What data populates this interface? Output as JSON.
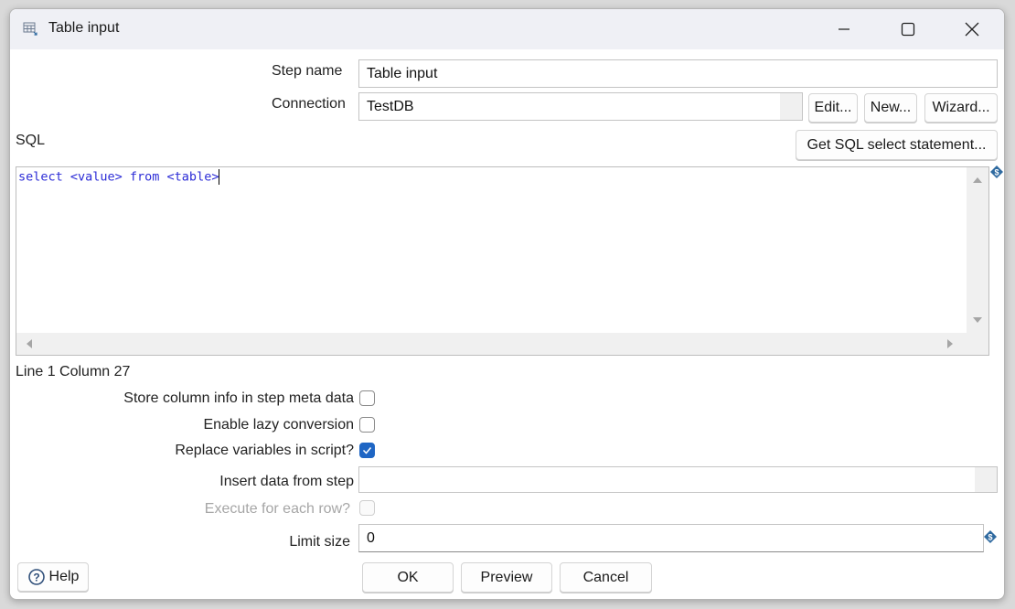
{
  "window": {
    "title": "Table input",
    "controls": [
      "minimize",
      "maximize",
      "close"
    ]
  },
  "form": {
    "step_name_label": "Step name",
    "step_name_value": "Table input",
    "connection_label": "Connection",
    "connection_value": "TestDB",
    "edit_button": "Edit...",
    "new_button": "New...",
    "wizard_button": "Wizard...",
    "sql_label": "SQL",
    "get_sql_button": "Get SQL select statement...",
    "sql_text": "select <value> from <table>",
    "cursor_position": "Line 1 Column 27",
    "store_column_info_label": "Store column info in step meta data",
    "store_column_info_checked": false,
    "lazy_conversion_label": "Enable lazy conversion",
    "lazy_conversion_checked": false,
    "replace_variables_label": "Replace variables in script?",
    "replace_variables_checked": true,
    "insert_data_label": "Insert data from step",
    "insert_data_value": "",
    "execute_each_row_label": "Execute for each row?",
    "execute_each_row_checked": false,
    "execute_each_row_enabled": false,
    "limit_size_label": "Limit size",
    "limit_size_value": "0"
  },
  "footer": {
    "help_button": "Help",
    "ok_button": "OK",
    "preview_button": "Preview",
    "cancel_button": "Cancel"
  },
  "colors": {
    "sql_text": "#2b2bd6",
    "checkbox_checked": "#1f66c4",
    "variable_icon": "#2f6aa0"
  }
}
